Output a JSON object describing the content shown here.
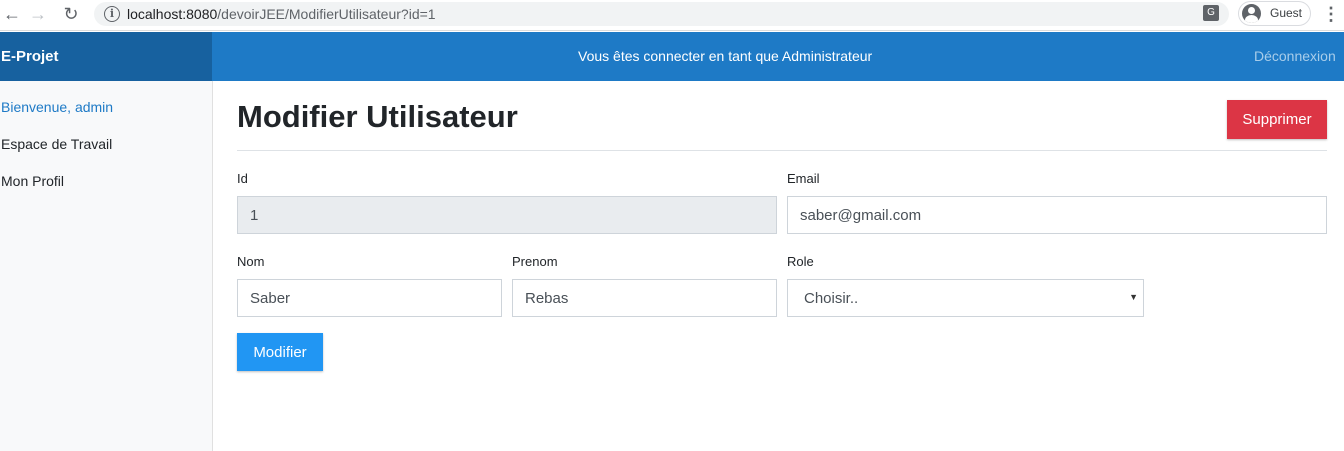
{
  "browser": {
    "url_host": "localhost:8080",
    "url_path": "/devoirJEE/ModifierUtilisateur?id=1",
    "profile_label": "Guest"
  },
  "header": {
    "brand": "E-Projet",
    "message": "Vous êtes connecter en tant que Administrateur",
    "logout": "Déconnexion"
  },
  "sidebar": {
    "items": [
      {
        "label": "Bienvenue, admin",
        "active": true
      },
      {
        "label": "Espace de Travail",
        "active": false
      },
      {
        "label": "Mon Profil",
        "active": false
      }
    ]
  },
  "main": {
    "title": "Modifier Utilisateur",
    "delete_label": "Supprimer",
    "submit_label": "Modifier",
    "fields": {
      "id": {
        "label": "Id",
        "value": "1"
      },
      "email": {
        "label": "Email",
        "value": "saber@gmail.com"
      },
      "nom": {
        "label": "Nom",
        "value": "Saber"
      },
      "prenom": {
        "label": "Prenom",
        "value": "Rebas"
      },
      "role": {
        "label": "Role",
        "value": "Choisir.."
      }
    }
  },
  "colors": {
    "header": "#1e7ac6",
    "brand_bg": "#17619f",
    "danger": "#dc3545",
    "primary": "#2196f3"
  }
}
